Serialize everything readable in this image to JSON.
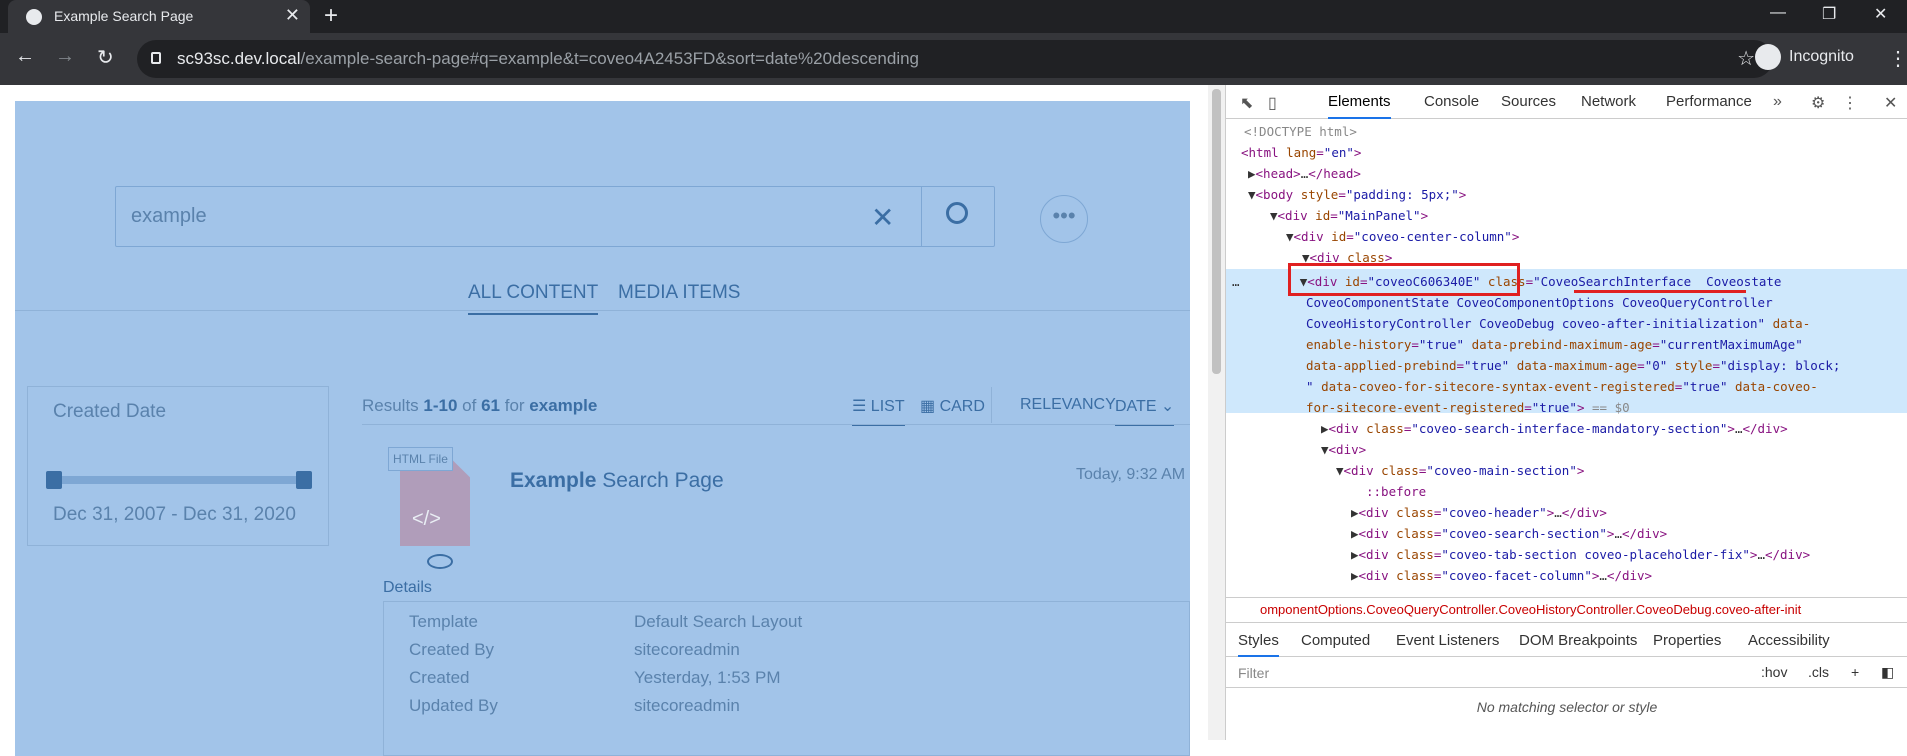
{
  "browser": {
    "tab_title": "Example Search Page",
    "new_tab": "+",
    "url_host": "sc93sc.dev.local",
    "url_path": "/example-search-page#q=example&t=coveo4A2453FD&sort=date%20descending",
    "incognito_label": "Incognito"
  },
  "search": {
    "query": "example",
    "more_label": "•••"
  },
  "tabs": [
    "ALL CONTENT",
    "MEDIA ITEMS"
  ],
  "facet": {
    "title": "Created Date",
    "range": "Dec 31, 2007 - Dec 31, 2020"
  },
  "results_summary": {
    "prefix": "Results ",
    "range": "1-10",
    "of": " of ",
    "total": "61",
    "for": " for ",
    "query": "example"
  },
  "layout_controls": {
    "list": "LIST",
    "card": "CARD",
    "relevancy": "RELEVANCY",
    "date": "DATE"
  },
  "result": {
    "file_type": "HTML File",
    "title_bold": "Example",
    "title_rest": " Search Page",
    "date": "Today, 9:32 AM",
    "details_label": "Details",
    "fields": [
      {
        "label": "Template",
        "value": "Default Search Layout"
      },
      {
        "label": "Created By",
        "value": "sitecoreadmin"
      },
      {
        "label": "Created",
        "value": "Yesterday, 1:53 PM"
      },
      {
        "label": "Updated By",
        "value": "sitecoreadmin"
      }
    ]
  },
  "devtools": {
    "tabs": [
      "Elements",
      "Console",
      "Sources",
      "Network",
      "Performance"
    ],
    "breadcrumb": "omponentOptions.CoveoQueryController.CoveoHistoryController.CoveoDebug.coveo-after-init",
    "style_tabs": [
      "Styles",
      "Computed",
      "Event Listeners",
      "DOM Breakpoints",
      "Properties",
      "Accessibility"
    ],
    "filter_placeholder": "Filter",
    "hov": ":hov",
    "cls": ".cls",
    "no_match": "No matching selector or style"
  }
}
